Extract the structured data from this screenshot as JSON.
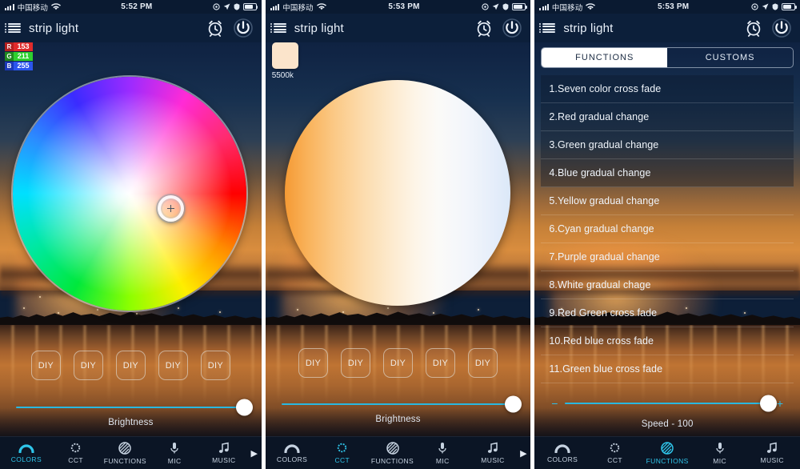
{
  "status_bar": {
    "carrier": "中国移动",
    "wifi_icon": "wifi-icon",
    "time_left": "5:52 PM",
    "time_mid": "5:53 PM",
    "time_right": "5:53 PM",
    "right_icons": [
      "alarm-icon",
      "location-arrow-icon",
      "rotation-lock-icon",
      "battery-icon"
    ]
  },
  "app": {
    "title": "strip light",
    "menu_icon": "hamburger-menu-icon",
    "alarm_icon": "alarm-clock-icon",
    "power_icon": "power-icon"
  },
  "colors_screen": {
    "rgb": {
      "r_label": "R",
      "r_value": "153",
      "g_label": "G",
      "g_value": "211",
      "b_label": "B",
      "b_value": "255"
    },
    "wheel": "color-wheel",
    "diy_buttons": [
      "DIY",
      "DIY",
      "DIY",
      "DIY",
      "DIY"
    ],
    "brightness_label": "Brightness",
    "brightness_value": 100
  },
  "cct_screen": {
    "swatch_color": "#fbe4cb",
    "swatch_label": "5500k",
    "wheel": "cct-wheel",
    "diy_buttons": [
      "DIY",
      "DIY",
      "DIY",
      "DIY",
      "DIY"
    ],
    "brightness_label": "Brightness",
    "brightness_value": 100
  },
  "functions_screen": {
    "tabs": [
      {
        "label": "FUNCTIONS",
        "selected": true
      },
      {
        "label": "CUSTOMS",
        "selected": false
      }
    ],
    "items": [
      "1.Seven color cross fade",
      "2.Red gradual change",
      "3.Green gradual change",
      "4.Blue gradual change",
      "5.Yellow gradual change",
      "6.Cyan gradual change",
      "7.Purple gradual change",
      "8.White gradual chage",
      "9.Red Green cross fade",
      "10.Red blue cross fade",
      "11.Green blue cross fade"
    ],
    "speed_minus": "−",
    "speed_plus": "+",
    "speed_label": "Speed - 100",
    "speed_value": 100
  },
  "tabbar": {
    "items": [
      {
        "label": "COLORS",
        "icon": "colors-arc-icon"
      },
      {
        "label": "CCT",
        "icon": "cct-gear-icon"
      },
      {
        "label": "FUNCTIONS",
        "icon": "functions-striped-circle-icon"
      },
      {
        "label": "MIC",
        "icon": "microphone-icon"
      },
      {
        "label": "MUSIC",
        "icon": "music-note-icon"
      }
    ],
    "more_arrow": "▶",
    "active_left": "COLORS",
    "active_mid": "CCT",
    "active_right": "FUNCTIONS"
  },
  "theme": {
    "accent": "#2fc5ea",
    "slider_track": "#29b8e0",
    "header_bg": "#0c1f3a",
    "tabbar_bg": "#0b1525"
  }
}
